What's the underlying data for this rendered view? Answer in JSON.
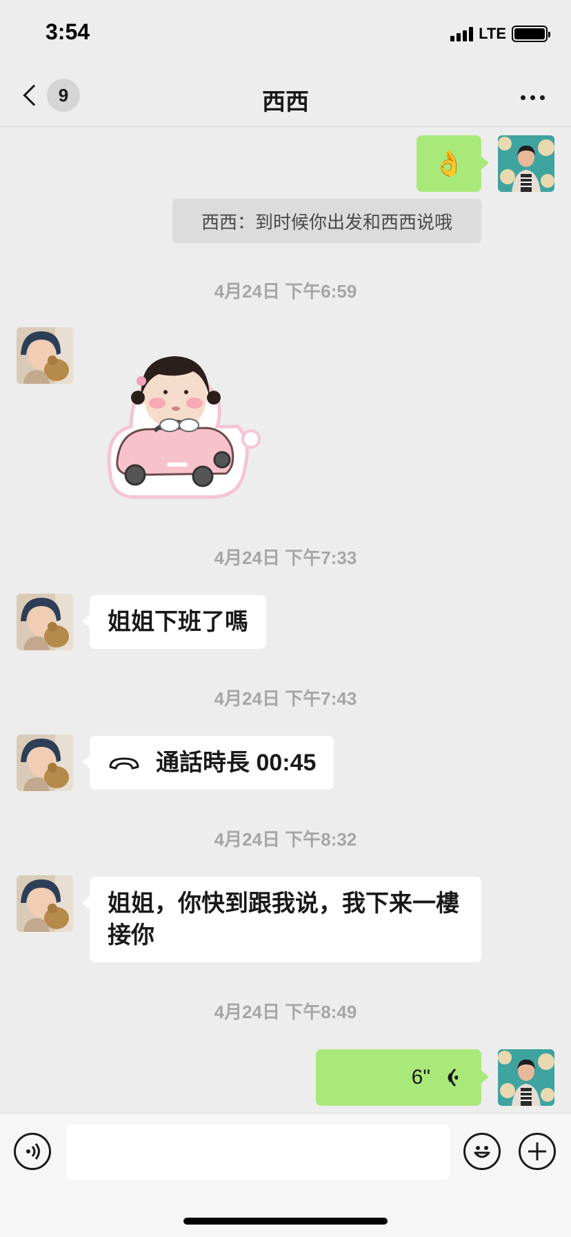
{
  "status_bar": {
    "time": "3:54",
    "network": "LTE",
    "battery_level": 1.0
  },
  "nav": {
    "unread_count": "9",
    "title": "西西"
  },
  "messages": {
    "ok_emoji": "👌",
    "system_notice": "西西：到时候你出发和西西说哦",
    "ts1": "4月24日 下午6:59",
    "ts2": "4月24日 下午7:33",
    "msg_off_work": "姐姐下班了嗎",
    "ts3": "4月24日 下午7:43",
    "call_duration": "通話時長 00:45",
    "ts4": "4月24日 下午8:32",
    "msg_pickup": "姐姐，你快到跟我说，我下来一樓接你",
    "ts5": "4月24日 下午8:49",
    "voice_length": "6\""
  },
  "input": {
    "value": "",
    "placeholder": ""
  },
  "colors": {
    "background": "#ededed",
    "sent_bubble": "#a9e97a",
    "received_bubble": "#ffffff",
    "timestamp": "#a6a6a6"
  },
  "icons": {
    "back": "chevron-left-icon",
    "more": "more-dots-icon",
    "voice_mode": "voice-mode-icon",
    "emoji": "emoji-icon",
    "plus": "plus-icon",
    "call": "phone-handset-icon",
    "voice_wave": "voice-wave-icon"
  }
}
